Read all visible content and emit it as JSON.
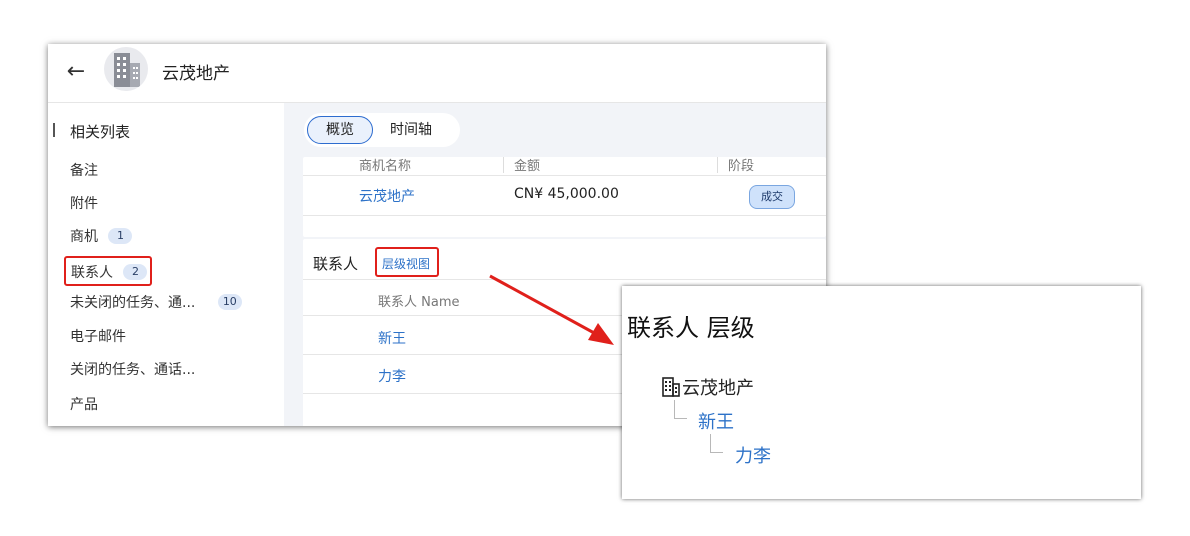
{
  "header": {
    "back_icon": "back-arrow-icon",
    "avatar_icon": "building-icon",
    "record_name": "云茂地产"
  },
  "sidebar": {
    "section_label": "相关列表",
    "items": [
      {
        "label": "备注",
        "badge": ""
      },
      {
        "label": "附件",
        "badge": ""
      },
      {
        "label": "商机",
        "badge": "1"
      },
      {
        "label": "联系人",
        "badge": "2"
      },
      {
        "label": "未关闭的任务、通...",
        "badge": "10"
      },
      {
        "label": "电子邮件",
        "badge": ""
      },
      {
        "label": "关闭的任务、通话...",
        "badge": ""
      },
      {
        "label": "产品",
        "badge": ""
      }
    ]
  },
  "tabs": [
    {
      "label": "概览",
      "active": true
    },
    {
      "label": "时间轴",
      "active": false
    }
  ],
  "deals": {
    "columns": [
      "商机名称",
      "金额",
      "阶段"
    ],
    "rows": [
      {
        "name": "云茂地产",
        "amount": "CN¥ 45,000.00",
        "stage": "成交"
      }
    ]
  },
  "contacts": {
    "title": "联系人",
    "hierarchy_link": "层级视图",
    "column": "联系人 Name",
    "rows": [
      "新王",
      "力李"
    ]
  },
  "popup": {
    "title": "联系人 层级",
    "root": "云茂地产",
    "level1": "新王",
    "level2": "力李"
  },
  "colors": {
    "highlight": "#e0201b",
    "link": "#2d72c8",
    "badge_bg": "#dde7f7"
  }
}
